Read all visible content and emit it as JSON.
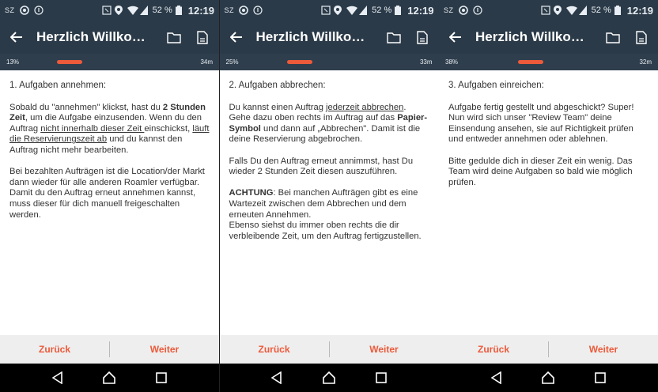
{
  "status": {
    "carrier": "SZ",
    "battery_pct": "52 %",
    "time": "12:19"
  },
  "icons": {
    "back": "arrow-left-icon",
    "folder": "folder-icon",
    "document": "document-icon",
    "nav_back": "triangle-back-icon",
    "nav_home": "home-icon",
    "nav_recent": "square-recent-icon"
  },
  "colors": {
    "appbar": "#2b3a48",
    "accent": "#ec5a3a",
    "footer": "#eeeeee"
  },
  "screens": [
    {
      "title": "Herzlich Willkomm...",
      "progress": {
        "label": "13%",
        "value": 0.13,
        "time": "34m"
      },
      "heading": "1. Aufgaben annehmen:",
      "p1": [
        "Sobald du \"annehmen\" klickst, hast du ",
        "2 Stunden Zeit",
        ", um die Aufgabe einzusenden. Wenn du den Auftrag ",
        "nicht innerhalb dieser Zeit ",
        "einschickst, ",
        "läuft die Reservierungszeit ab",
        " und du kannst den Auftrag nicht mehr bearbeiten."
      ],
      "p2": "Bei bezahlten Aufträgen ist die Location/der Markt dann wieder für alle anderen Roamler verfügbar. Damit du den Auftrag erneut annehmen kannst, muss dieser für dich manuell freigeschalten werden.",
      "back_label": "Zurück",
      "next_label": "Weiter"
    },
    {
      "title": "Herzlich Willkomm...",
      "progress": {
        "label": "25%",
        "value": 0.25,
        "time": "33m"
      },
      "heading": "2. Aufgaben abbrechen:",
      "p1": [
        "Du kannst einen Auftrag ",
        "jederzeit abbrechen",
        ". Gehe dazu oben rechts im Auftrag auf das ",
        "Papier-Symbol",
        " und dann auf „Abbrechen\". Damit ist die deine Reservierung abgebrochen."
      ],
      "p2": "Falls Du den Auftrag erneut annimmst, hast Du wieder 2 Stunden Zeit diesen auszuführen.",
      "p3": [
        "ACHTUNG",
        ": Bei manchen Aufträgen gibt es eine Wartezeit zwischen dem Abbrechen und dem erneuten Annehmen.",
        "Ebenso siehst du immer oben rechts die dir verbleibende Zeit, um den Auftrag fertigzustellen."
      ],
      "back_label": "Zurück",
      "next_label": "Weiter"
    },
    {
      "title": "Herzlich Willkomm...",
      "progress": {
        "label": "38%",
        "value": 0.38,
        "time": "32m"
      },
      "heading": "3. Aufgaben einreichen:",
      "p1": [
        "Aufgabe fertig gestellt und abgeschickt? Super!",
        "Nun wird sich unser \"Review Team\" deine Einsendung ansehen, sie auf Richtigkeit prüfen und entweder annehmen oder ablehnen."
      ],
      "p2": "Bitte gedulde dich in dieser Zeit ein wenig. Das Team wird deine Aufgaben so bald wie möglich prüfen.",
      "back_label": "Zurück",
      "next_label": "Weiter"
    }
  ]
}
